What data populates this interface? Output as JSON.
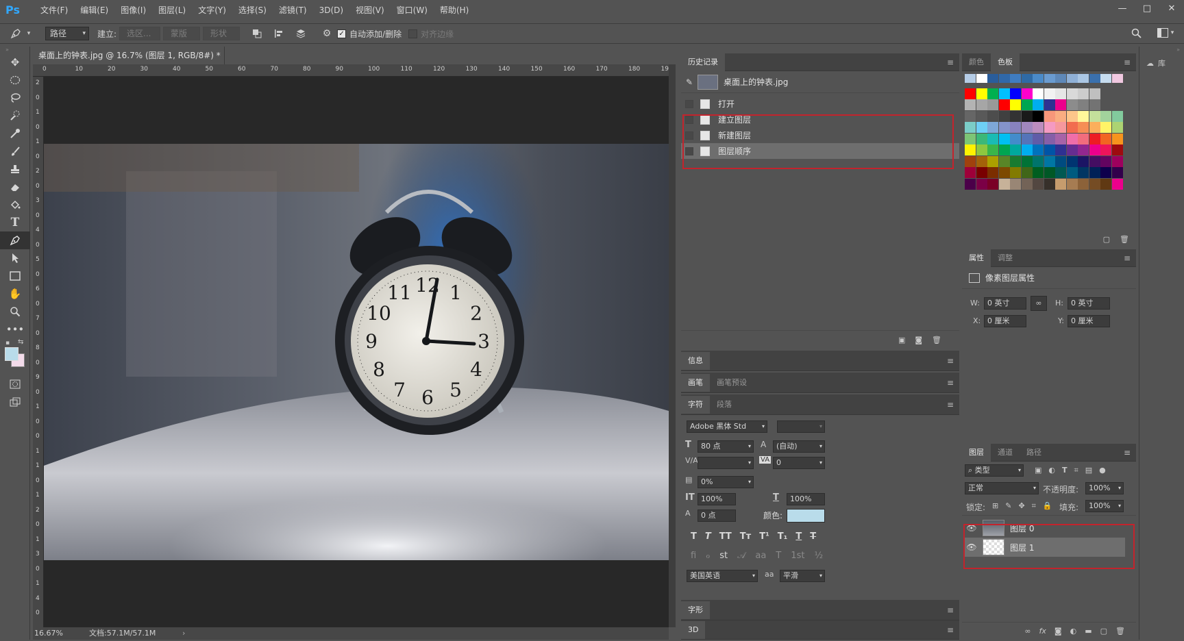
{
  "app": {
    "logo": "Ps"
  },
  "menu": [
    "文件(F)",
    "编辑(E)",
    "图像(I)",
    "图层(L)",
    "文字(Y)",
    "选择(S)",
    "滤镜(T)",
    "3D(D)",
    "视图(V)",
    "窗口(W)",
    "帮助(H)"
  ],
  "window_buttons": [
    "—",
    "□",
    "✕"
  ],
  "options": {
    "mode": "路径",
    "build_label": "建立:",
    "btn_selection": "选区...",
    "btn_mask": "蒙版",
    "btn_shape": "形状",
    "auto_add_delete": "自动添加/删除",
    "align_edges": "对齐边缘"
  },
  "document": {
    "tab_title": "桌面上的钟表.jpg @ 16.7% (图层 1, RGB/8#) *",
    "close": "×",
    "zoom": "16.67%",
    "doc_size": "文档:57.1M/57.1M",
    "ruler_h": [
      "0",
      "10",
      "20",
      "30",
      "40",
      "50",
      "60",
      "70",
      "80",
      "90",
      "100",
      "110",
      "120",
      "130",
      "140",
      "150",
      "160",
      "170",
      "180",
      "19"
    ],
    "ruler_v": [
      "2",
      "0",
      "1",
      "0",
      "1",
      "0",
      "2",
      "0",
      "3",
      "0",
      "4",
      "0",
      "5",
      "0",
      "6",
      "0",
      "7",
      "0",
      "8",
      "0",
      "9",
      "0",
      "1",
      "0",
      "0",
      "1",
      "1",
      "0",
      "1",
      "2",
      "0",
      "1",
      "3",
      "0",
      "1",
      "4",
      "0"
    ]
  },
  "clock": {
    "numerals": [
      "12",
      "1",
      "2",
      "3",
      "4",
      "5",
      "6",
      "7",
      "8",
      "9",
      "10",
      "11"
    ]
  },
  "history": {
    "tab": "历史记录",
    "snapshot": "桌面上的钟表.jpg",
    "items": [
      "打开",
      "建立图层",
      "新建图层",
      "图层顺序"
    ]
  },
  "swatches_panel": {
    "tabs": [
      "颜色",
      "色板"
    ]
  },
  "properties": {
    "tabs": [
      "属性",
      "调整"
    ],
    "title": "像素图层属性",
    "w_label": "W:",
    "w_value": "0 英寸",
    "h_label": "H:",
    "h_value": "0 英寸",
    "x_label": "X:",
    "x_value": "0 厘米",
    "y_label": "Y:",
    "y_value": "0 厘米"
  },
  "info_tab": "信息",
  "brush_tabs": [
    "画笔",
    "画笔预设"
  ],
  "char_tabs": [
    "字符",
    "段落"
  ],
  "character": {
    "font": "Adobe 黑体 Std",
    "size": "80 点",
    "leading": "(自动)",
    "tracking": "0",
    "scale_pct": "0%",
    "vscale": "100%",
    "hscale": "100%",
    "baseline": "0 点",
    "color_label": "颜色:",
    "language": "美国英语",
    "aa": "平滑",
    "aa_label": "aa",
    "color": "#b9dcea"
  },
  "glyph_tab": "字形",
  "threed_tab": "3D",
  "layers": {
    "tabs": [
      "图层",
      "通道",
      "路径"
    ],
    "filter": "类型",
    "blend": "正常",
    "opacity_label": "不透明度:",
    "opacity": "100%",
    "lock_label": "锁定:",
    "fill_label": "填充:",
    "fill": "100%",
    "rows": [
      {
        "name": "图层 0"
      },
      {
        "name": "图层 1"
      }
    ]
  },
  "library": {
    "label": "库"
  },
  "swatch_colors": {
    "row0": [
      "#b5cce6",
      "#ffffff",
      "#2a5d9b",
      "#3068a8",
      "#3f7cc0",
      "#2f6aa5",
      "#4a8ac8",
      "#6a9bd0",
      "#5e88b8",
      "#8fb0d6",
      "#aac6e3",
      "#3a70ad",
      "#c6dcef",
      "#f0c8e0"
    ],
    "row1": [
      "#ff0000",
      "#ffff00",
      "#00b050",
      "#00c0ff",
      "#0000ff",
      "#ff00cc",
      "#ffffff",
      "#f2f2f2",
      "#e6e6e6",
      "#d9d9d9",
      "#cccccc",
      "#bfbfbf"
    ],
    "row2": [
      "#b3b3b3",
      "#a6a6a6",
      "#999999",
      "#ff0000",
      "#ffff00",
      "#00a651",
      "#00aeef",
      "#2e3192",
      "#ec008c",
      "#8c8c8c",
      "#808080",
      "#737373"
    ],
    "row3": [
      "#666666",
      "#595959",
      "#4d4d4d",
      "#404040",
      "#333333",
      "#1a1a1a",
      "#000000",
      "#f7977a",
      "#f9ad81",
      "#fdc68a",
      "#fff79a",
      "#c4df9b",
      "#a2d39c",
      "#82ca9d"
    ],
    "row4": [
      "#7bcdc8",
      "#6ecff6",
      "#7ea7d8",
      "#8493ca",
      "#8882be",
      "#a187be",
      "#bc8dbf",
      "#f49ac2",
      "#f6989d",
      "#f26c4f",
      "#f68e55",
      "#fbaf5c",
      "#fff467",
      "#acd372"
    ],
    "row5": [
      "#7cc576",
      "#3bb878",
      "#1abbb4",
      "#00bff3",
      "#438ccb",
      "#5574b9",
      "#605ca8",
      "#855fa8",
      "#a763a8",
      "#f06ea9",
      "#f26d7d",
      "#ed1c24",
      "#f26522",
      "#f7941d"
    ],
    "row6": [
      "#fff200",
      "#8dc73f",
      "#39b54a",
      "#00a651",
      "#00a99d",
      "#00aeef",
      "#0072bc",
      "#0054a6",
      "#2e3192",
      "#662d91",
      "#92278f",
      "#ec008c",
      "#ed145b",
      "#9e0b0f"
    ],
    "row7": [
      "#a0410d",
      "#a36209",
      "#aba000",
      "#598527",
      "#197b30",
      "#007236",
      "#00746b",
      "#0076a3",
      "#004b80",
      "#003471",
      "#1b1464",
      "#440e62",
      "#630460",
      "#9e005d"
    ],
    "row8": [
      "#9e0039",
      "#790000",
      "#7b2e00",
      "#7d4900",
      "#827b00",
      "#406618",
      "#005e20",
      "#005826",
      "#005952",
      "#005b7f",
      "#003663",
      "#002157",
      "#0d004c",
      "#32004b"
    ],
    "row9": [
      "#4b0049",
      "#7b0046",
      "#7a0026",
      "#c7b299",
      "#998675",
      "#736357",
      "#534741",
      "#37302a",
      "#c69c6d",
      "#a67c52",
      "#8c6239",
      "#754c24",
      "#603913",
      "#ec008c"
    ]
  }
}
